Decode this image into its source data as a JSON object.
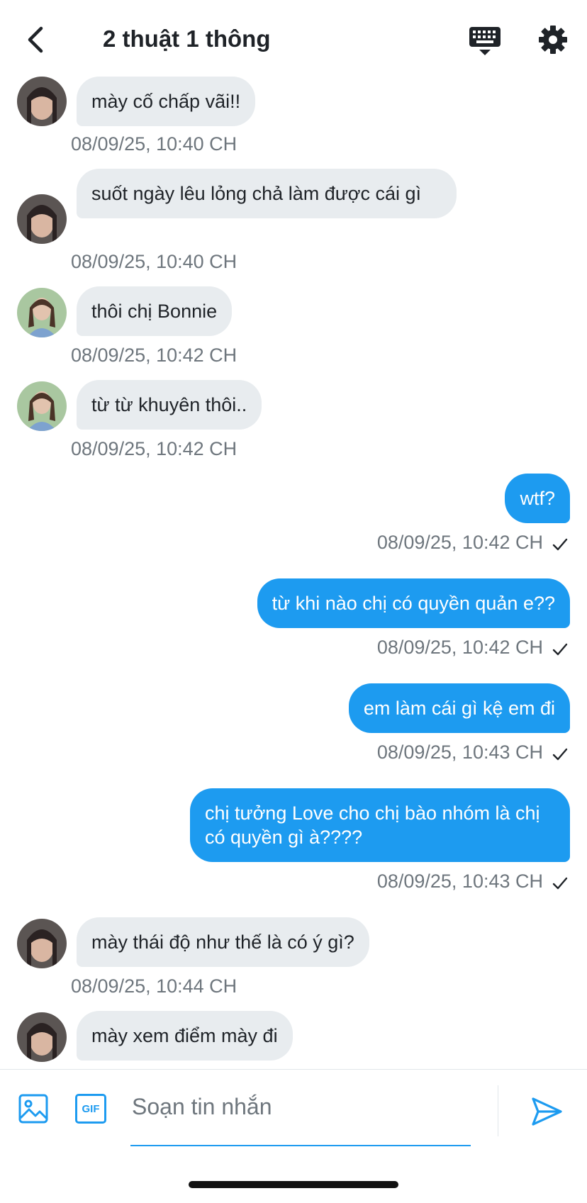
{
  "header": {
    "title": "2 thuật 1 thông",
    "icons": [
      "back-arrow-icon",
      "keyboard-icon",
      "gear-icon"
    ]
  },
  "messages": [
    {
      "side": "in",
      "avatar": "avatar-1",
      "text": "mày cố chấp vãi!!",
      "time": "08/09/25, 10:40 CH"
    },
    {
      "side": "in",
      "avatar": "avatar-1",
      "text": "suốt ngày lêu lỏng chả làm được cái gì",
      "time": "08/09/25, 10:40 CH"
    },
    {
      "side": "in",
      "avatar": "avatar-2",
      "text": "thôi chị Bonnie",
      "time": "08/09/25, 10:42 CH"
    },
    {
      "side": "in",
      "avatar": "avatar-2",
      "text": "từ từ khuyên thôi..",
      "time": "08/09/25, 10:42 CH"
    },
    {
      "side": "out",
      "text": "wtf?",
      "time": "08/09/25, 10:42 CH",
      "status": "✓"
    },
    {
      "side": "out",
      "text": "từ khi nào chị có quyền quản e??",
      "time": "08/09/25, 10:42 CH",
      "status": "✓"
    },
    {
      "side": "out",
      "text": "em làm cái gì kệ em đi",
      "time": "08/09/25, 10:43 CH",
      "status": "✓"
    },
    {
      "side": "out",
      "text": "chị tưởng Love cho chị bào nhóm là chị có quyền gì à????",
      "time": "08/09/25, 10:43 CH",
      "status": "✓"
    },
    {
      "side": "in",
      "avatar": "avatar-1",
      "text": "mày thái độ như thế là có ý gì?",
      "time": "08/09/25, 10:44 CH"
    },
    {
      "side": "in",
      "avatar": "avatar-1",
      "text": "mày xem điểm mày đi",
      "time": ""
    }
  ],
  "composer": {
    "placeholder": "Soạn tin nhắn",
    "gif_label": "GIF"
  },
  "colors": {
    "outgoing_bubble": "#1d9bf0",
    "incoming_bubble": "#e8ecef",
    "timestamp": "#6e767d"
  }
}
